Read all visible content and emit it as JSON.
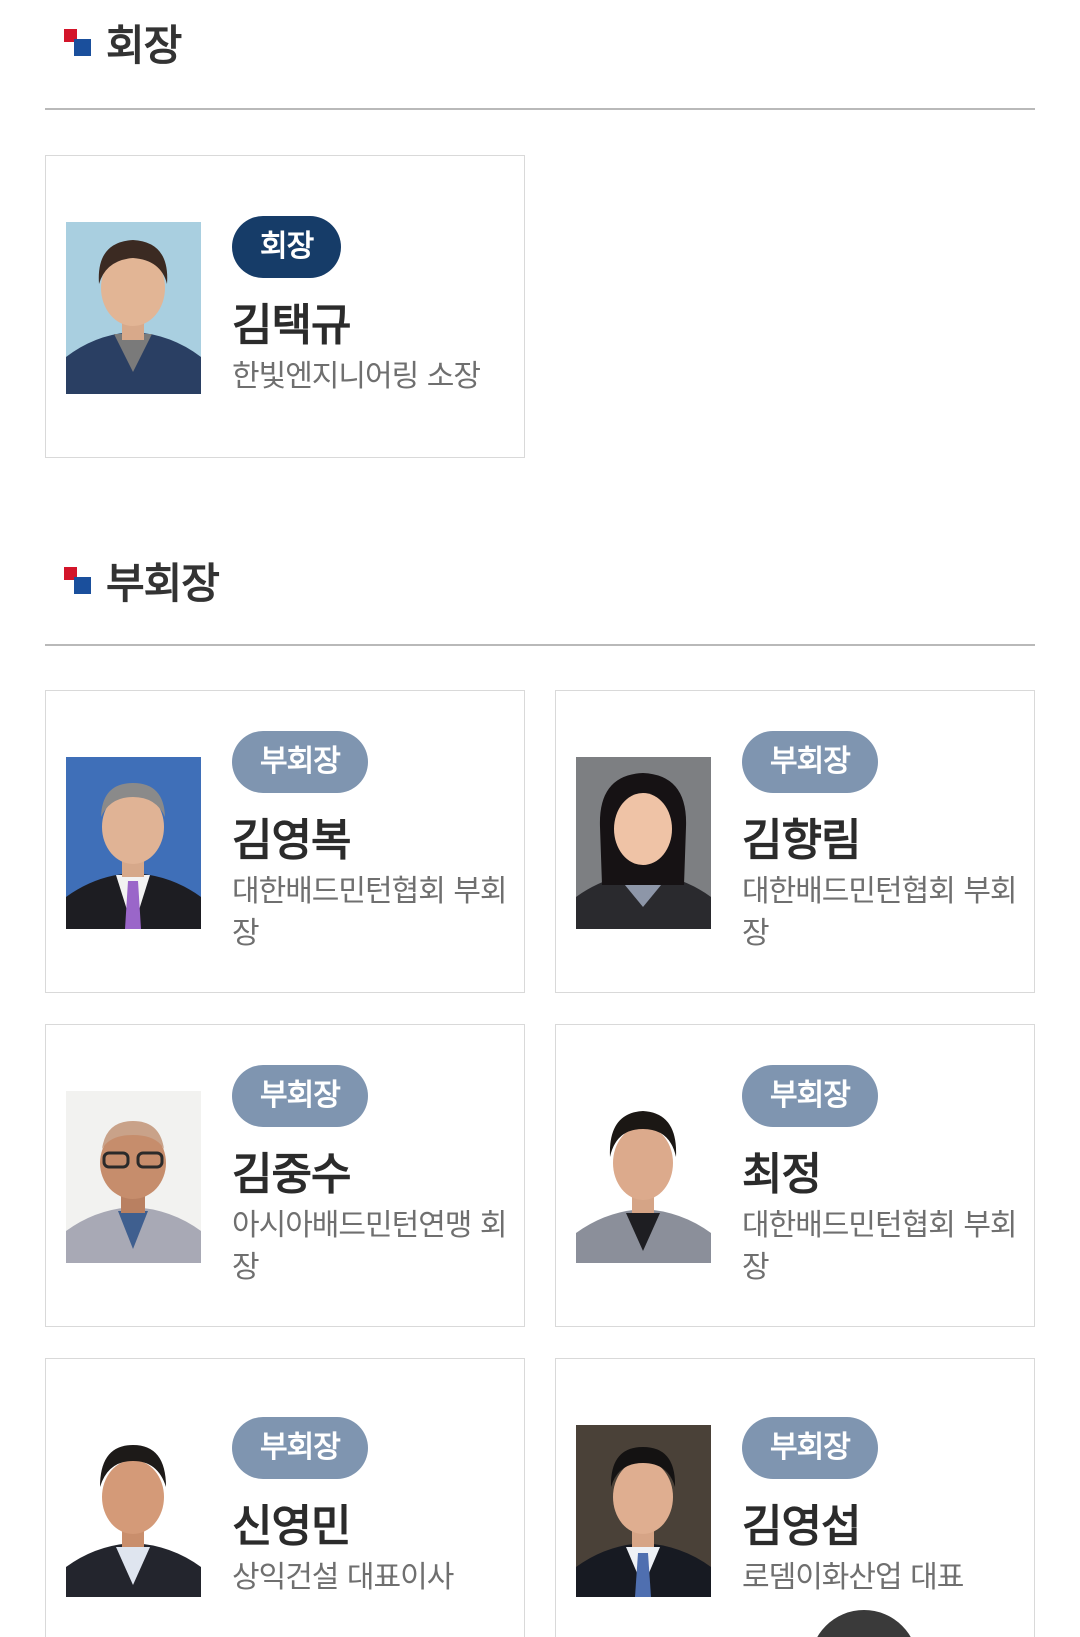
{
  "sections": {
    "chairman": {
      "title": "회장"
    },
    "vice": {
      "title": "부회장"
    }
  },
  "chairman": {
    "badge": "회장",
    "name": "김택규",
    "desc": "한빛엔지니어링 소장"
  },
  "vice_members": [
    {
      "badge": "부회장",
      "name": "김영복",
      "desc": "대한배드민턴협회 부회장"
    },
    {
      "badge": "부회장",
      "name": "김향림",
      "desc": "대한배드민턴협회 부회장"
    },
    {
      "badge": "부회장",
      "name": "김중수",
      "desc": "아시아배드민턴연맹 회장"
    },
    {
      "badge": "부회장",
      "name": "최정",
      "desc": "대한배드민턴협회 부회장"
    },
    {
      "badge": "부회장",
      "name": "신영민",
      "desc": "상익건설 대표이사"
    },
    {
      "badge": "부회장",
      "name": "김영섭",
      "desc": "로뎀이화산업 대표"
    }
  ],
  "icons": {
    "section_mark": "section-bullet-icon",
    "scroll_top": "scroll-top-button"
  },
  "colors": {
    "chair_badge": "#163c68",
    "vice_badge": "#7f95b0",
    "mark_red": "#d3152a",
    "mark_blue": "#1a4f9c"
  }
}
